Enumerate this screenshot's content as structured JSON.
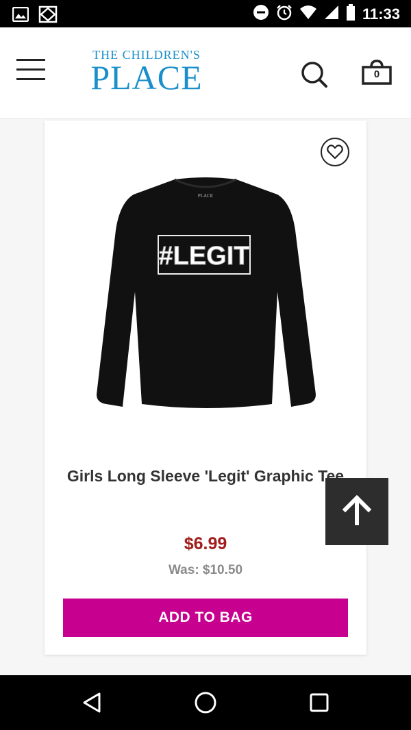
{
  "status_bar": {
    "time": "11:33",
    "icons": [
      "image-icon",
      "vpn-diamond-icon",
      "do-not-disturb-icon",
      "alarm-icon",
      "wifi-icon",
      "signal-icon",
      "battery-icon"
    ]
  },
  "header": {
    "menu_icon": "hamburger-menu-icon",
    "logo_top": "THE CHILDREN'S",
    "logo_main": "PLACE",
    "search_icon": "search-icon",
    "bag_icon": "shopping-bag-icon",
    "bag_count": "0",
    "logo_color": "#1a8fc9"
  },
  "product": {
    "favorite_icon": "heart-icon",
    "image_icon": "black-long-sleeve-tee-image",
    "tee_graphic": "#LEGIT",
    "tee_tag": "PLACE",
    "name": "Girls Long Sleeve 'Legit' Graphic Tee",
    "price": "$6.99",
    "was_price": "Was: $10.50",
    "add_to_bag_label": "ADD TO BAG",
    "price_color": "#a31d1d",
    "button_color": "#c8008f"
  },
  "scroll_top": {
    "icon": "arrow-up-icon"
  },
  "nav_bar": {
    "back_icon": "back-triangle-icon",
    "home_icon": "home-circle-icon",
    "recents_icon": "recents-square-icon"
  }
}
